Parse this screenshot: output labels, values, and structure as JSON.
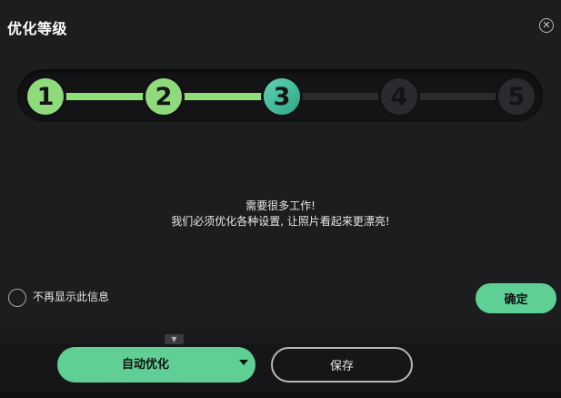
{
  "dialog": {
    "title": "优化等级",
    "close_icon": "close-icon"
  },
  "stepper": {
    "steps": [
      {
        "label": "1",
        "state": "done"
      },
      {
        "label": "2",
        "state": "done"
      },
      {
        "label": "3",
        "state": "current"
      },
      {
        "label": "4",
        "state": "todo"
      },
      {
        "label": "5",
        "state": "todo"
      }
    ],
    "colors": {
      "done": "#8fdb7c",
      "current": "#3bbf9c",
      "todo": "#2a2b2e"
    }
  },
  "message": {
    "line1": "需要很多工作!",
    "line2": "我们必须优化各种设置, 让照片看起来更漂亮!"
  },
  "options": {
    "dont_show_label": "不再显示此信息"
  },
  "buttons": {
    "ok_label": "确定",
    "auto_optimize_label": "自动优化",
    "save_label": "保存"
  },
  "colors": {
    "accent": "#5fcf94",
    "background": "#1c1d1f"
  }
}
